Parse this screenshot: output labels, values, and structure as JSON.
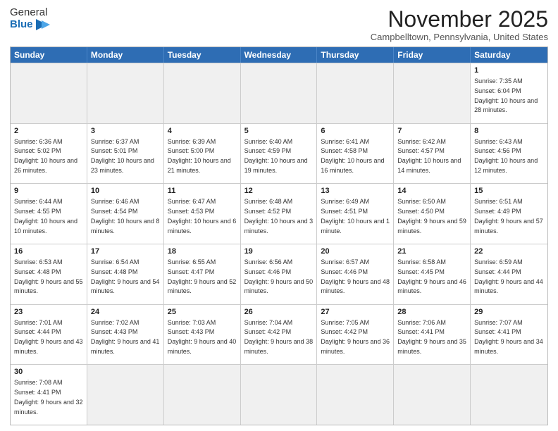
{
  "header": {
    "logo_general": "General",
    "logo_blue": "Blue",
    "month": "November 2025",
    "location": "Campbelltown, Pennsylvania, United States"
  },
  "days_of_week": [
    "Sunday",
    "Monday",
    "Tuesday",
    "Wednesday",
    "Thursday",
    "Friday",
    "Saturday"
  ],
  "weeks": [
    [
      {
        "day": "",
        "info": "",
        "empty": true
      },
      {
        "day": "",
        "info": "",
        "empty": true
      },
      {
        "day": "",
        "info": "",
        "empty": true
      },
      {
        "day": "",
        "info": "",
        "empty": true
      },
      {
        "day": "",
        "info": "",
        "empty": true
      },
      {
        "day": "",
        "info": "",
        "empty": true
      },
      {
        "day": "1",
        "info": "Sunrise: 7:35 AM\nSunset: 6:04 PM\nDaylight: 10 hours and 28 minutes.",
        "empty": false
      }
    ],
    [
      {
        "day": "2",
        "info": "Sunrise: 6:36 AM\nSunset: 5:02 PM\nDaylight: 10 hours and 26 minutes.",
        "empty": false
      },
      {
        "day": "3",
        "info": "Sunrise: 6:37 AM\nSunset: 5:01 PM\nDaylight: 10 hours and 23 minutes.",
        "empty": false
      },
      {
        "day": "4",
        "info": "Sunrise: 6:39 AM\nSunset: 5:00 PM\nDaylight: 10 hours and 21 minutes.",
        "empty": false
      },
      {
        "day": "5",
        "info": "Sunrise: 6:40 AM\nSunset: 4:59 PM\nDaylight: 10 hours and 19 minutes.",
        "empty": false
      },
      {
        "day": "6",
        "info": "Sunrise: 6:41 AM\nSunset: 4:58 PM\nDaylight: 10 hours and 16 minutes.",
        "empty": false
      },
      {
        "day": "7",
        "info": "Sunrise: 6:42 AM\nSunset: 4:57 PM\nDaylight: 10 hours and 14 minutes.",
        "empty": false
      },
      {
        "day": "8",
        "info": "Sunrise: 6:43 AM\nSunset: 4:56 PM\nDaylight: 10 hours and 12 minutes.",
        "empty": false
      }
    ],
    [
      {
        "day": "9",
        "info": "Sunrise: 6:44 AM\nSunset: 4:55 PM\nDaylight: 10 hours and 10 minutes.",
        "empty": false
      },
      {
        "day": "10",
        "info": "Sunrise: 6:46 AM\nSunset: 4:54 PM\nDaylight: 10 hours and 8 minutes.",
        "empty": false
      },
      {
        "day": "11",
        "info": "Sunrise: 6:47 AM\nSunset: 4:53 PM\nDaylight: 10 hours and 6 minutes.",
        "empty": false
      },
      {
        "day": "12",
        "info": "Sunrise: 6:48 AM\nSunset: 4:52 PM\nDaylight: 10 hours and 3 minutes.",
        "empty": false
      },
      {
        "day": "13",
        "info": "Sunrise: 6:49 AM\nSunset: 4:51 PM\nDaylight: 10 hours and 1 minute.",
        "empty": false
      },
      {
        "day": "14",
        "info": "Sunrise: 6:50 AM\nSunset: 4:50 PM\nDaylight: 9 hours and 59 minutes.",
        "empty": false
      },
      {
        "day": "15",
        "info": "Sunrise: 6:51 AM\nSunset: 4:49 PM\nDaylight: 9 hours and 57 minutes.",
        "empty": false
      }
    ],
    [
      {
        "day": "16",
        "info": "Sunrise: 6:53 AM\nSunset: 4:48 PM\nDaylight: 9 hours and 55 minutes.",
        "empty": false
      },
      {
        "day": "17",
        "info": "Sunrise: 6:54 AM\nSunset: 4:48 PM\nDaylight: 9 hours and 54 minutes.",
        "empty": false
      },
      {
        "day": "18",
        "info": "Sunrise: 6:55 AM\nSunset: 4:47 PM\nDaylight: 9 hours and 52 minutes.",
        "empty": false
      },
      {
        "day": "19",
        "info": "Sunrise: 6:56 AM\nSunset: 4:46 PM\nDaylight: 9 hours and 50 minutes.",
        "empty": false
      },
      {
        "day": "20",
        "info": "Sunrise: 6:57 AM\nSunset: 4:46 PM\nDaylight: 9 hours and 48 minutes.",
        "empty": false
      },
      {
        "day": "21",
        "info": "Sunrise: 6:58 AM\nSunset: 4:45 PM\nDaylight: 9 hours and 46 minutes.",
        "empty": false
      },
      {
        "day": "22",
        "info": "Sunrise: 6:59 AM\nSunset: 4:44 PM\nDaylight: 9 hours and 44 minutes.",
        "empty": false
      }
    ],
    [
      {
        "day": "23",
        "info": "Sunrise: 7:01 AM\nSunset: 4:44 PM\nDaylight: 9 hours and 43 minutes.",
        "empty": false
      },
      {
        "day": "24",
        "info": "Sunrise: 7:02 AM\nSunset: 4:43 PM\nDaylight: 9 hours and 41 minutes.",
        "empty": false
      },
      {
        "day": "25",
        "info": "Sunrise: 7:03 AM\nSunset: 4:43 PM\nDaylight: 9 hours and 40 minutes.",
        "empty": false
      },
      {
        "day": "26",
        "info": "Sunrise: 7:04 AM\nSunset: 4:42 PM\nDaylight: 9 hours and 38 minutes.",
        "empty": false
      },
      {
        "day": "27",
        "info": "Sunrise: 7:05 AM\nSunset: 4:42 PM\nDaylight: 9 hours and 36 minutes.",
        "empty": false
      },
      {
        "day": "28",
        "info": "Sunrise: 7:06 AM\nSunset: 4:41 PM\nDaylight: 9 hours and 35 minutes.",
        "empty": false
      },
      {
        "day": "29",
        "info": "Sunrise: 7:07 AM\nSunset: 4:41 PM\nDaylight: 9 hours and 34 minutes.",
        "empty": false
      }
    ],
    [
      {
        "day": "30",
        "info": "Sunrise: 7:08 AM\nSunset: 4:41 PM\nDaylight: 9 hours and 32 minutes.",
        "empty": false
      },
      {
        "day": "",
        "info": "",
        "empty": true
      },
      {
        "day": "",
        "info": "",
        "empty": true
      },
      {
        "day": "",
        "info": "",
        "empty": true
      },
      {
        "day": "",
        "info": "",
        "empty": true
      },
      {
        "day": "",
        "info": "",
        "empty": true
      },
      {
        "day": "",
        "info": "",
        "empty": true
      }
    ]
  ]
}
